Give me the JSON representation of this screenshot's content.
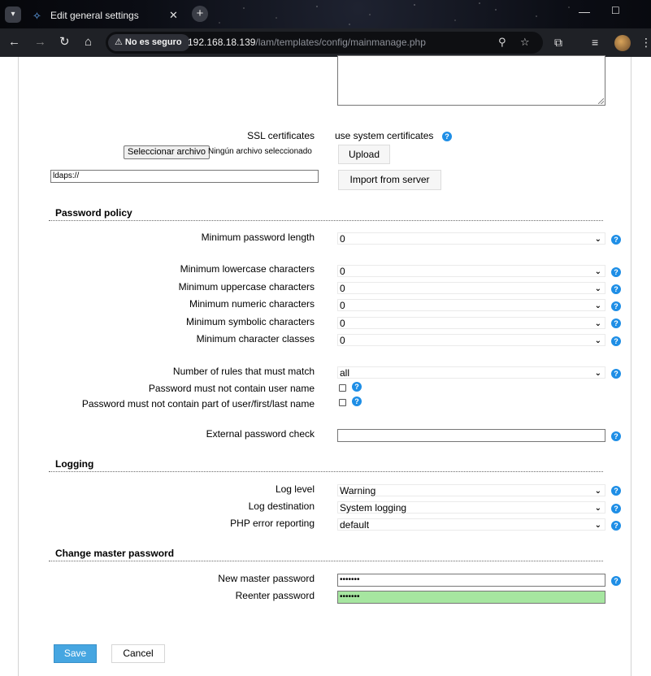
{
  "browser": {
    "tab_title": "Edit general settings",
    "security_badge": "No es seguro",
    "url_host": "192.168.18.139",
    "url_path": "/lam/templates/config/mainmanage.php",
    "icons": [
      "tab-menu-icon",
      "favicon",
      "close-icon",
      "new-tab-icon",
      "back-icon",
      "forward-icon",
      "reload-icon",
      "home-icon",
      "warning-icon",
      "zoom-icon",
      "bookmark-star-icon",
      "extensions-icon",
      "reading-list-icon",
      "profile-avatar",
      "menu-icon"
    ]
  },
  "ssl": {
    "label": "SSL certificates",
    "status": "use system certificates",
    "file_button": "Seleccionar archivo",
    "file_status": "Ningún archivo seleccionado",
    "upload_button": "Upload",
    "server_input_value": "ldaps://",
    "import_button": "Import from server"
  },
  "password_policy": {
    "title": "Password policy",
    "min_length": {
      "label": "Minimum password length",
      "value": "0"
    },
    "min_lower": {
      "label": "Minimum lowercase characters",
      "value": "0"
    },
    "min_upper": {
      "label": "Minimum uppercase characters",
      "value": "0"
    },
    "min_numeric": {
      "label": "Minimum numeric characters",
      "value": "0"
    },
    "min_symbolic": {
      "label": "Minimum symbolic characters",
      "value": "0"
    },
    "min_classes": {
      "label": "Minimum character classes",
      "value": "0"
    },
    "rules_match": {
      "label": "Number of rules that must match",
      "value": "all"
    },
    "no_username": {
      "label": "Password must not contain user name",
      "checked": false
    },
    "no_part_name": {
      "label": "Password must not contain part of user/first/last name",
      "checked": false
    },
    "external_check": {
      "label": "External password check",
      "value": ""
    }
  },
  "logging": {
    "title": "Logging",
    "log_level": {
      "label": "Log level",
      "value": "Warning"
    },
    "log_destination": {
      "label": "Log destination",
      "value": "System logging"
    },
    "php_error": {
      "label": "PHP error reporting",
      "value": "default"
    }
  },
  "master_password": {
    "title": "Change master password",
    "new_password": {
      "label": "New master password",
      "value": "•••••••"
    },
    "reenter_password": {
      "label": "Reenter password",
      "value": "•••••••"
    }
  },
  "actions": {
    "save": "Save",
    "cancel": "Cancel"
  },
  "icon_glyphs": {
    "help": "?",
    "chevron": "⌄"
  },
  "colors": {
    "help_icon": "#1e8ee6",
    "save_button": "#46a6e1",
    "password_match": "#a6e6a0"
  }
}
